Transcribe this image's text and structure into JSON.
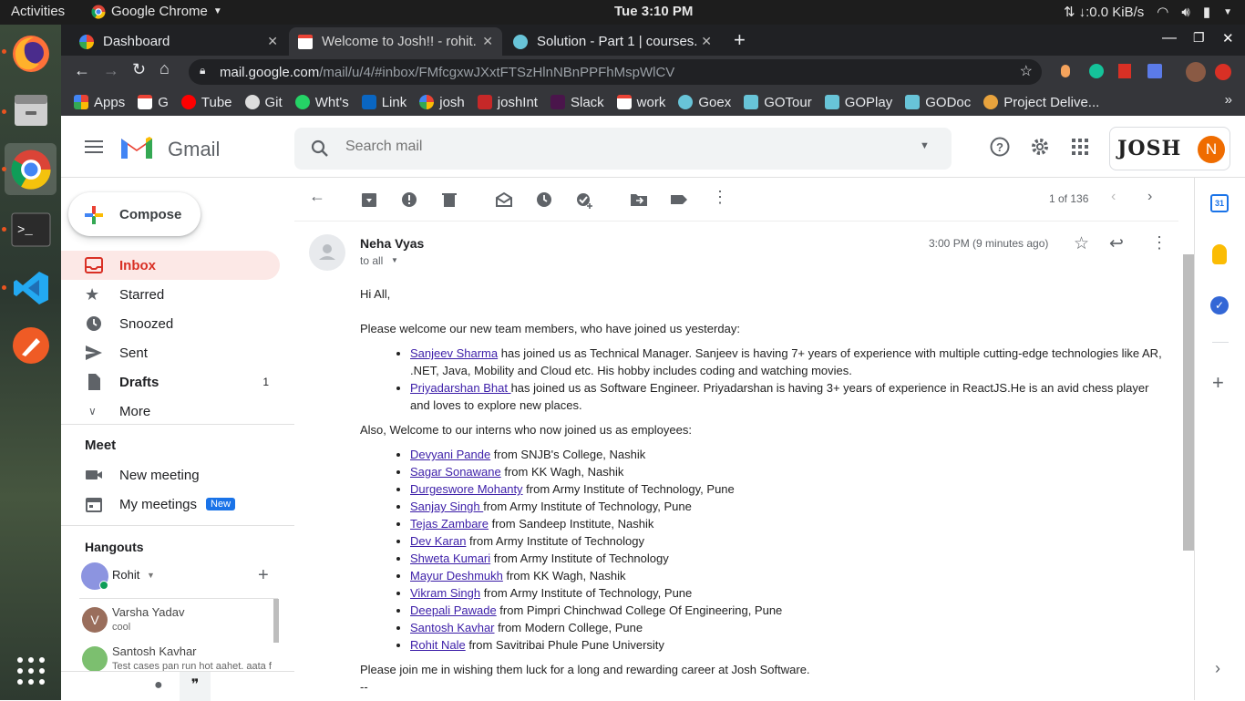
{
  "os": {
    "activities": "Activities",
    "app_name": "Google Chrome",
    "clock": "Tue  3:10 PM",
    "network_speed": "↓:0.0 KiB/s"
  },
  "chrome": {
    "tabs": [
      {
        "label": "Dashboard"
      },
      {
        "label": "Welcome to Josh!! - rohit."
      },
      {
        "label": "Solution - Part 1 | courses."
      }
    ],
    "new_tab": "+",
    "url_host": "mail.google.com",
    "url_path": "/mail/u/4/#inbox/FMfcgxwJXxtFTSzHlnNBnPPFhMspWlCV",
    "bookmarks": [
      "Apps",
      "G",
      "Tube",
      "Git",
      "Wht's",
      "Link",
      "josh",
      "joshInt",
      "Slack",
      "work",
      "Goex",
      "GOTour",
      "GOPlay",
      "GODoc",
      "Project Delive..."
    ]
  },
  "gmail": {
    "logo_text": "Gmail",
    "search_placeholder": "Search mail",
    "avatar_letter": "N",
    "brand_name": "JOSH",
    "compose_label": "Compose",
    "nav": [
      {
        "label": "Inbox",
        "count": ""
      },
      {
        "label": "Starred",
        "count": ""
      },
      {
        "label": "Snoozed",
        "count": ""
      },
      {
        "label": "Sent",
        "count": ""
      },
      {
        "label": "Drafts",
        "count": "1"
      },
      {
        "label": "More",
        "count": ""
      }
    ],
    "meet": {
      "title": "Meet",
      "new_meeting": "New meeting",
      "my_meetings": "My meetings",
      "new_badge": "New"
    },
    "hangouts": {
      "title": "Hangouts",
      "user": "Rohit",
      "contacts": [
        {
          "initial": "V",
          "name": "Varsha Yadav",
          "status": "cool"
        },
        {
          "initial": "",
          "name": "Santosh Kavhar",
          "status": "Test cases pan run hot aahet. aata f"
        }
      ]
    },
    "pagination": "1 of 136"
  },
  "email": {
    "sender": "Neha Vyas",
    "recipient": "to all",
    "time": "3:00 PM (9 minutes ago)",
    "greeting": "Hi All,",
    "intro": "Please welcome our new team members, who have joined us yesterday:",
    "new_members": [
      {
        "name": "Sanjeev Sharma",
        "text": " has joined us as Technical Manager. Sanjeev is having 7+ years of experience with multiple cutting-edge technologies like AR, .NET, Java, Mobility and Cloud etc. His hobby includes coding and watching movies."
      },
      {
        "name": "Priyadarshan Bhat ",
        "text": "has joined us as Software Engineer. Priyadarshan is having 3+ years of experience in ReactJS.He is an avid chess player and loves to explore new places."
      }
    ],
    "interns_intro": "Also, Welcome to our interns who now joined us as employees:",
    "interns": [
      {
        "name": "Devyani Pande",
        "text": " from  SNJB's College, Nashik"
      },
      {
        "name": "Sagar Sonawane",
        "text": " from KK Wagh, Nashik"
      },
      {
        "name": "Durgeswore Mohanty",
        "text": " from Army Institute of Technology, Pune"
      },
      {
        "name": "Sanjay Singh ",
        "text": "from Army Institute of Technology, Pune"
      },
      {
        "name": "Tejas Zambare",
        "text": " from Sandeep Institute, Nashik"
      },
      {
        "name": "Dev Karan",
        "text": " from Army Institute of Technology"
      },
      {
        "name": "Shweta Kumari",
        "text": " from Army Institute of Technology"
      },
      {
        "name": "Mayur Deshmukh",
        "text": " from KK Wagh, Nashik"
      },
      {
        "name": "Vikram Singh",
        "text": " from Army Institute of Technology, Pune"
      },
      {
        "name": "Deepali Pawade",
        "text": " from  Pimpri Chinchwad College Of Engineering, Pune"
      },
      {
        "name": "Santosh Kavhar",
        "text": " from Modern College, Pune"
      },
      {
        "name": "Rohit Nale",
        "text": " from Savitribai Phule Pune University"
      }
    ],
    "closing": "Please join me in wishing them luck for a long and rewarding career at Josh Software.",
    "signature_sep": "--"
  },
  "colors": {
    "gmail_red": "#d93025",
    "inbox_highlight": "#fce8e6",
    "link": "#3c1ea8",
    "chrome_dark": "#35363a"
  }
}
